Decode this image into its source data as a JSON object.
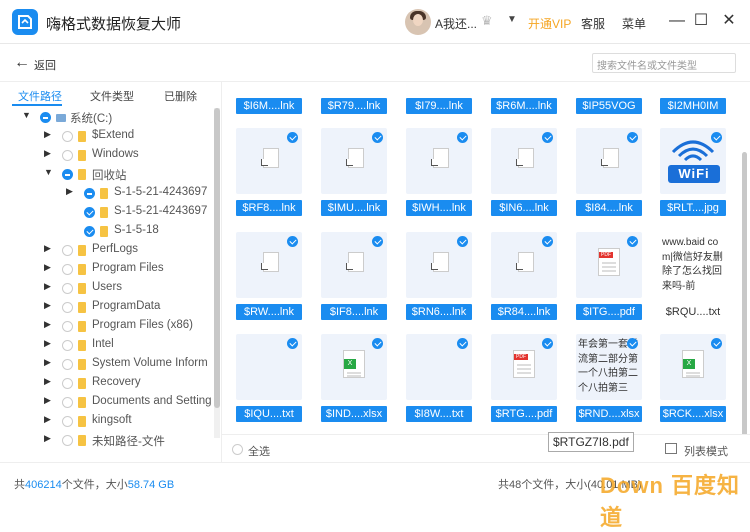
{
  "app": {
    "title": "嗨格式数据恢复大师",
    "username": "A我还...",
    "vip_label": "开通VIP",
    "service_label": "客服",
    "menu_label": "菜单"
  },
  "toolbar": {
    "back_label": "返回",
    "search_placeholder": "搜索文件名或文件类型"
  },
  "tabs": [
    "文件路径",
    "文件类型",
    "已删除"
  ],
  "tree": [
    {
      "label": "系统(C:)",
      "indent": 0,
      "arrow": "▼",
      "check": "part",
      "icon": "drive"
    },
    {
      "label": "$Extend",
      "indent": 1,
      "arrow": "▶",
      "check": "none",
      "icon": "folder"
    },
    {
      "label": "Windows",
      "indent": 1,
      "arrow": "▶",
      "check": "none",
      "icon": "folder"
    },
    {
      "label": "回收站",
      "indent": 1,
      "arrow": "▼",
      "check": "part",
      "icon": "folder"
    },
    {
      "label": "S-1-5-21-4243697",
      "indent": 2,
      "arrow": "▶",
      "check": "part",
      "icon": "folder"
    },
    {
      "label": "S-1-5-21-4243697",
      "indent": 2,
      "arrow": "",
      "check": "full",
      "icon": "folder"
    },
    {
      "label": "S-1-5-18",
      "indent": 2,
      "arrow": "",
      "check": "full",
      "icon": "folder"
    },
    {
      "label": "PerfLogs",
      "indent": 1,
      "arrow": "▶",
      "check": "none",
      "icon": "folder"
    },
    {
      "label": "Program Files",
      "indent": 1,
      "arrow": "▶",
      "check": "none",
      "icon": "folder"
    },
    {
      "label": "Users",
      "indent": 1,
      "arrow": "▶",
      "check": "none",
      "icon": "folder"
    },
    {
      "label": "ProgramData",
      "indent": 1,
      "arrow": "▶",
      "check": "none",
      "icon": "folder"
    },
    {
      "label": "Program Files (x86)",
      "indent": 1,
      "arrow": "▶",
      "check": "none",
      "icon": "folder"
    },
    {
      "label": "Intel",
      "indent": 1,
      "arrow": "▶",
      "check": "none",
      "icon": "folder"
    },
    {
      "label": "System Volume Inform",
      "indent": 1,
      "arrow": "▶",
      "check": "none",
      "icon": "folder"
    },
    {
      "label": "Recovery",
      "indent": 1,
      "arrow": "▶",
      "check": "none",
      "icon": "folder"
    },
    {
      "label": "Documents and Setting",
      "indent": 1,
      "arrow": "▶",
      "check": "none",
      "icon": "folder"
    },
    {
      "label": "kingsoft",
      "indent": 1,
      "arrow": "▶",
      "check": "none",
      "icon": "folder"
    },
    {
      "label": "未知路径-文件",
      "indent": 1,
      "arrow": "▶",
      "check": "none",
      "icon": "folder"
    }
  ],
  "top_names": [
    "$I6M....lnk",
    "$R79....lnk",
    "$I79....lnk",
    "$R6M....lnk",
    "$IP55VOG",
    "$I2MH0IM"
  ],
  "files": [
    {
      "name": "$RF8....lnk",
      "kind": "lnk",
      "checked": true
    },
    {
      "name": "$IMU....lnk",
      "kind": "lnk",
      "checked": true
    },
    {
      "name": "$IWH....lnk",
      "kind": "lnk",
      "checked": true
    },
    {
      "name": "$IN6....lnk",
      "kind": "lnk",
      "checked": true
    },
    {
      "name": "$I84....lnk",
      "kind": "lnk",
      "checked": true
    },
    {
      "name": "$RLT....jpg",
      "kind": "wifi",
      "checked": true,
      "preview": "WiFi"
    },
    {
      "name": "$RW....lnk",
      "kind": "lnk",
      "checked": true
    },
    {
      "name": "$IF8....lnk",
      "kind": "lnk",
      "checked": true
    },
    {
      "name": "$RN6....lnk",
      "kind": "lnk",
      "checked": true
    },
    {
      "name": "$R84....lnk",
      "kind": "lnk",
      "checked": true
    },
    {
      "name": "$ITG....pdf",
      "kind": "pdf",
      "checked": true
    },
    {
      "name": "$RQU....txt",
      "kind": "text",
      "checked": false,
      "plain": true,
      "preview": "www.baid com|微信好友删除了怎么找回来吗-前"
    },
    {
      "name": "$IQU....txt",
      "kind": "blank",
      "checked": true
    },
    {
      "name": "$IND....xlsx",
      "kind": "xls",
      "checked": true
    },
    {
      "name": "$I8W....txt",
      "kind": "blank",
      "checked": true
    },
    {
      "name": "$RTG....pdf",
      "kind": "pdf",
      "checked": true
    },
    {
      "name": "$RND....xlsx",
      "kind": "text",
      "checked": true,
      "preview": "年会第一套学流第二部分第一个八拍第二个八拍第三"
    },
    {
      "name": "$RCK....xlsx",
      "kind": "xls",
      "checked": true
    }
  ],
  "footer": {
    "select_all": "全选",
    "tooltip": "$RTGZ7I8.pdf",
    "list_mode": "列表模式"
  },
  "status": {
    "left_prefix": "共",
    "left_count": "406214",
    "left_mid": "个文件，大小",
    "left_size": "58.74 GB",
    "right": "共48个文件，大小(40.01 MB)",
    "watermark": "Down 百度知道"
  },
  "colors": {
    "accent": "#1a8cf0",
    "vip": "#f5a623",
    "folder": "#f6c343"
  }
}
